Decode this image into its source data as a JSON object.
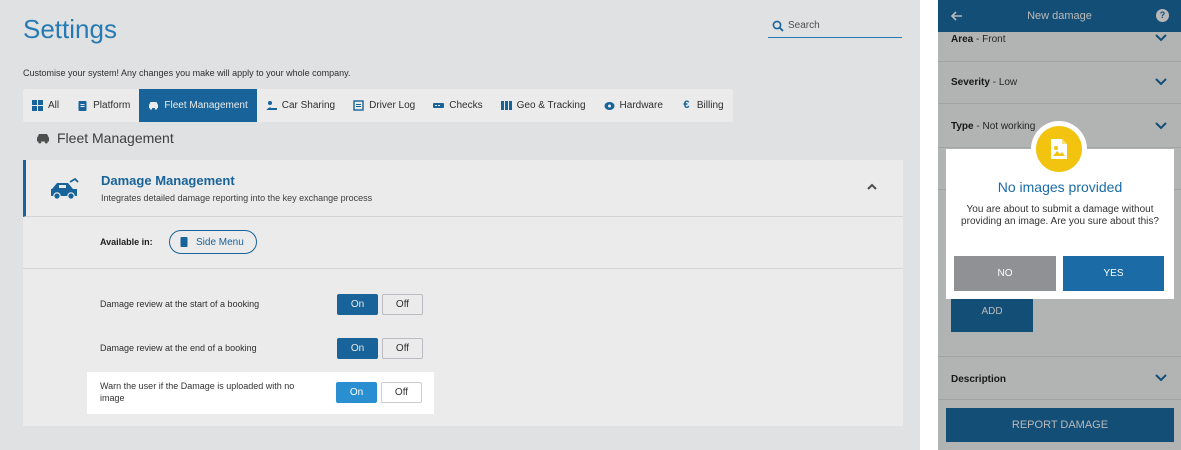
{
  "settings": {
    "title": "Settings",
    "search_placeholder": "Search",
    "subtitle": "Customise your system! Any changes you make will apply to your whole company.",
    "tabs": [
      {
        "label": "All",
        "icon": "grid-icon"
      },
      {
        "label": "Platform",
        "icon": "clipboard-icon"
      },
      {
        "label": "Fleet Management",
        "icon": "car-icon",
        "active": true
      },
      {
        "label": "Car Sharing",
        "icon": "users-icon"
      },
      {
        "label": "Driver Log",
        "icon": "log-icon"
      },
      {
        "label": "Checks",
        "icon": "checks-icon"
      },
      {
        "label": "Geo & Tracking",
        "icon": "map-icon"
      },
      {
        "label": "Hardware",
        "icon": "hardware-icon"
      },
      {
        "label": "Billing",
        "icon": "euro-icon"
      }
    ],
    "section_title": "Fleet Management",
    "card": {
      "title": "Damage Management",
      "description": "Integrates detailed damage reporting into the key exchange process",
      "available_label": "Available in:",
      "chip_label": "Side Menu",
      "options": [
        {
          "label": "Damage review at the start of a booking",
          "on_label": "On",
          "off_label": "Off",
          "value": "On"
        },
        {
          "label": "Damage review at the end of a booking",
          "on_label": "On",
          "off_label": "Off",
          "value": "On"
        },
        {
          "label": "Warn the user if the Damage is uploaded with no image",
          "on_label": "On",
          "off_label": "Off",
          "value": "On"
        }
      ]
    }
  },
  "phone": {
    "title": "New damage",
    "rows": [
      {
        "name": "Area",
        "value": "Front"
      },
      {
        "name": "Severity",
        "value": "Low"
      },
      {
        "name": "Type",
        "value": "Not working"
      }
    ],
    "add_label": "ADD",
    "description_label": "Description",
    "report_label": "REPORT DAMAGE",
    "dialog": {
      "title": "No images provided",
      "message": "You are about to submit a damage without providing an image. Are you sure about this?",
      "no_label": "NO",
      "yes_label": "YES"
    }
  },
  "colors": {
    "primary": "#1b6ca6",
    "accent": "#2a86c4",
    "badge": "#f2c40f",
    "no_button": "#8f9194"
  }
}
